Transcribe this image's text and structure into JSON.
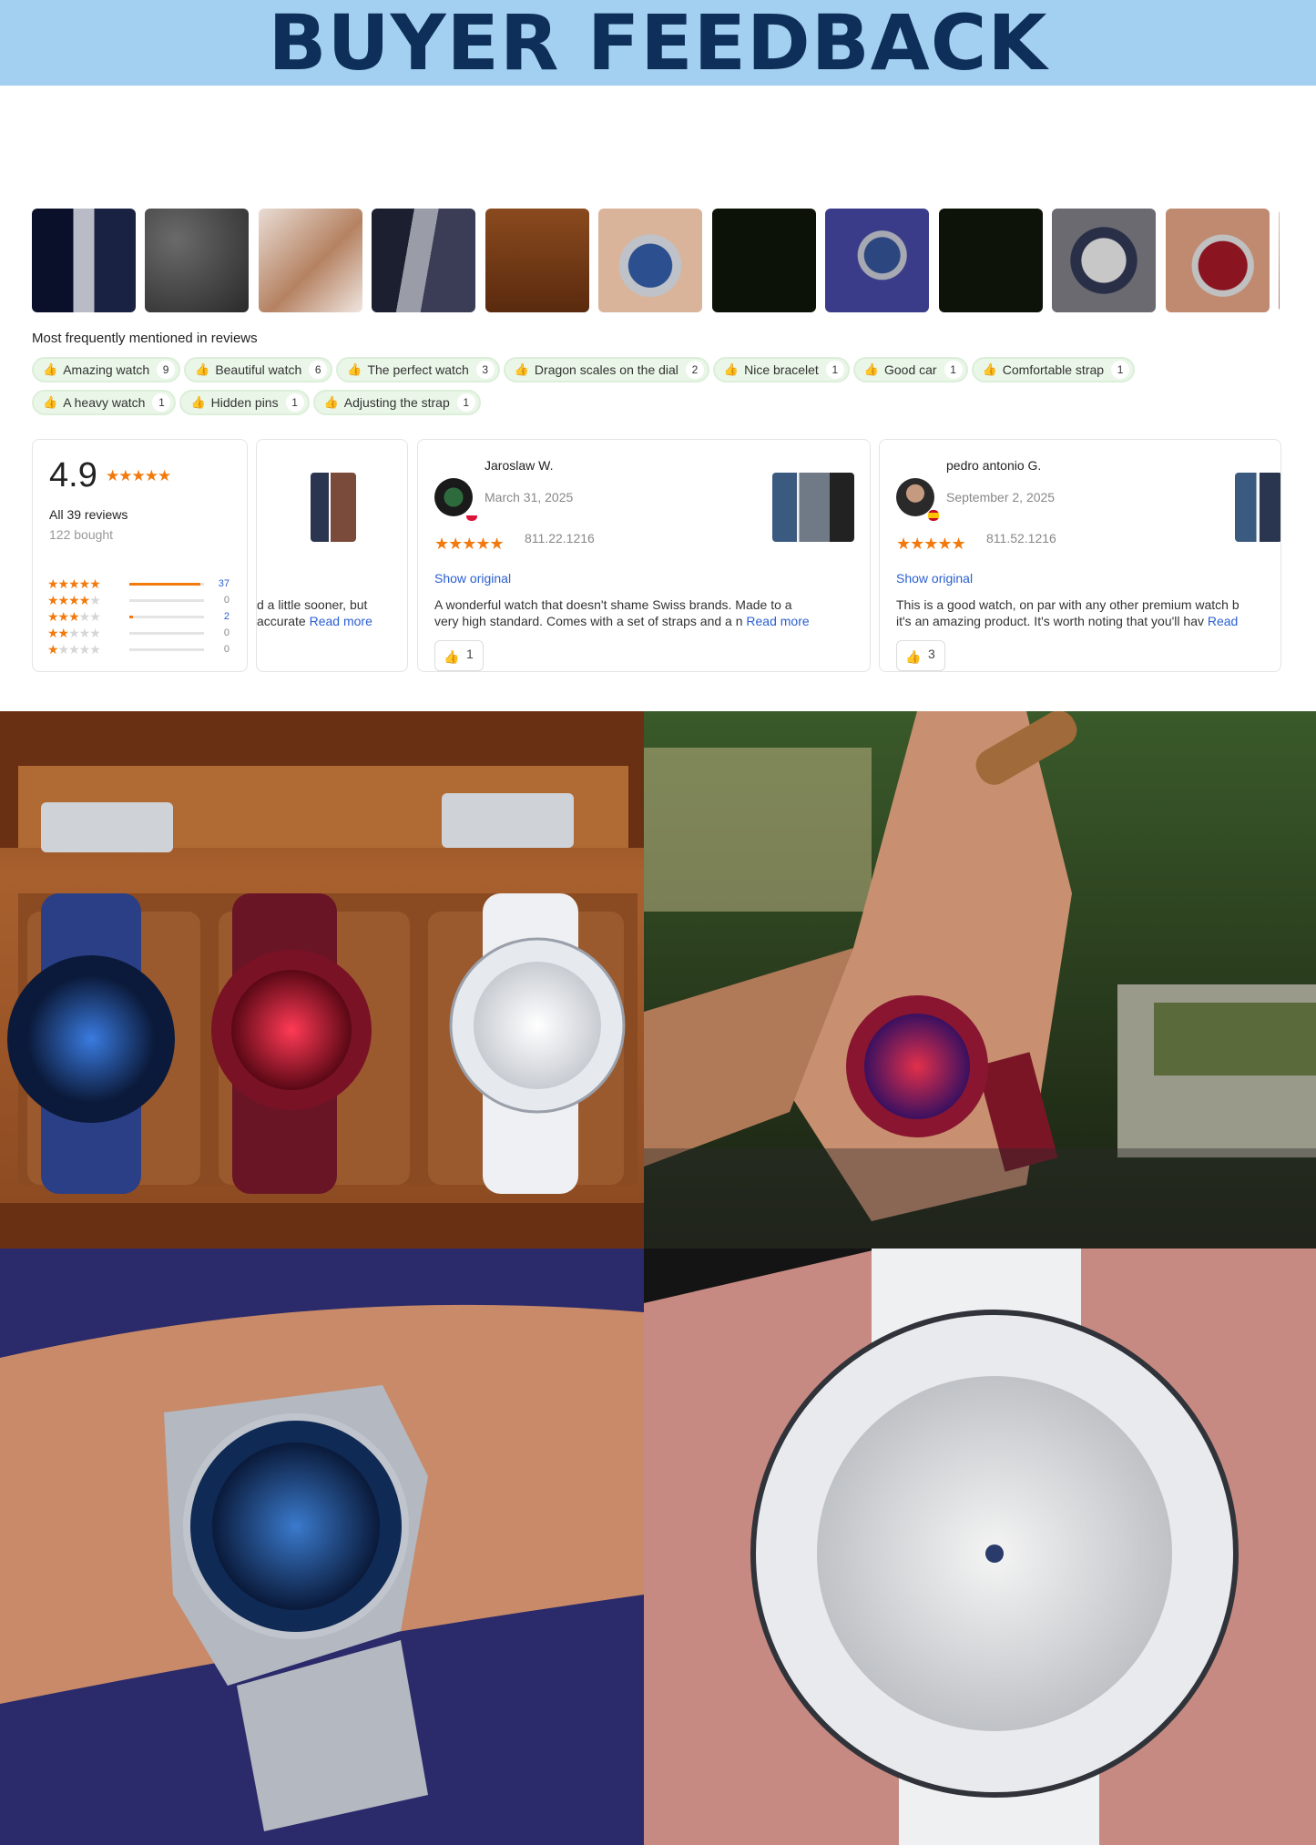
{
  "banner": {
    "title": "BUYER FEEDBACK"
  },
  "thumbnails": [
    {
      "label": "",
      "icon": "review-photo-bracelet-box"
    },
    {
      "label": "",
      "icon": "review-photo-texture"
    },
    {
      "label": "",
      "icon": "review-photo-strap-hand"
    },
    {
      "label": "",
      "icon": "review-photo-bracelet"
    },
    {
      "label": "",
      "icon": "review-photo-watch-box"
    },
    {
      "label": "",
      "icon": "review-photo-blue-watch-hand"
    },
    {
      "label": "",
      "icon": "review-photo-timegrapher"
    },
    {
      "label": "",
      "icon": "review-photo-blue-wrist"
    },
    {
      "label": "",
      "icon": "review-photo-timegrapher-2"
    },
    {
      "label": "",
      "icon": "review-photo-caseback"
    },
    {
      "label": "",
      "icon": "review-photo-red-caseback"
    },
    {
      "label": "",
      "icon": "review-photo-strap"
    }
  ],
  "mentions": {
    "title": "Most frequently mentioned in reviews",
    "tags": [
      {
        "label": "Amazing watch",
        "count": "9"
      },
      {
        "label": "Beautiful watch",
        "count": "6"
      },
      {
        "label": "The perfect watch",
        "count": "3"
      },
      {
        "label": "Dragon scales on the dial",
        "count": "2"
      },
      {
        "label": "Nice bracelet",
        "count": "1"
      },
      {
        "label": "Good car",
        "count": "1"
      },
      {
        "label": "Comfortable strap",
        "count": "1"
      },
      {
        "label": "A heavy watch",
        "count": "1"
      },
      {
        "label": "Hidden pins",
        "count": "1"
      },
      {
        "label": "Adjusting the strap",
        "count": "1"
      }
    ]
  },
  "summary": {
    "score": "4.9",
    "stars": "★★★★★",
    "all_reviews": "All 39 reviews",
    "bought": "122 bought",
    "distribution": [
      {
        "stars": 5,
        "count": "37",
        "fraction": 0.95
      },
      {
        "stars": 4,
        "count": "0",
        "fraction": 0
      },
      {
        "stars": 3,
        "count": "2",
        "fraction": 0.05
      },
      {
        "stars": 2,
        "count": "0",
        "fraction": 0
      },
      {
        "stars": 1,
        "count": "0",
        "fraction": 0
      }
    ]
  },
  "reviews": [
    {
      "name": "",
      "date": "",
      "sku": "",
      "text": "d a little sooner, but",
      "text2": "accurate",
      "read_more": "Read more"
    },
    {
      "name": "Jaroslaw W.",
      "date": "March 31, 2025",
      "stars": "★★★★★",
      "sku": "811.22.1216",
      "show_original": "Show original",
      "text": "A wonderful watch that doesn't shame Swiss brands. Made to a",
      "text2": "very high standard. Comes with a set of straps and a n",
      "read_more": "Read more",
      "likes": "1"
    },
    {
      "name": "pedro antonio G.",
      "date": "September 2, 2025",
      "stars": "★★★★★",
      "sku": "811.52.1216",
      "show_original": "Show original",
      "text": "This is a good watch, on par with any other premium watch b",
      "text2": "it's an amazing product. It's worth noting that you'll hav",
      "read_more": "Read",
      "likes": "3"
    }
  ],
  "colors": {
    "banner_bg": "#a3d0f0",
    "banner_text": "#0e2f59",
    "star": "#f27a0d",
    "link": "#2a5fd1",
    "tag_bg": "#eaf6e8"
  }
}
